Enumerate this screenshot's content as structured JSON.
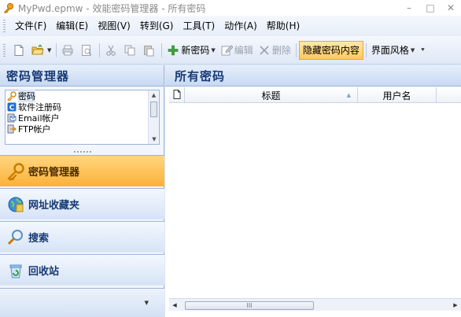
{
  "window": {
    "title": "MyPwd.epmw - 效能密码管理器 - 所有密码",
    "minimize": "–",
    "maximize": "□",
    "close": "✕"
  },
  "menu": [
    "文件(F)",
    "编辑(E)",
    "视图(V)",
    "转到(G)",
    "工具(T)",
    "动作(A)",
    "帮助(H)"
  ],
  "toolbar": {
    "new_label": "新密码",
    "edit_label": "编辑",
    "delete_label": "删除",
    "hide_label": "隐藏密码内容",
    "theme_label": "界面风格"
  },
  "left": {
    "title": "密码管理器",
    "tree": [
      {
        "label": "密码",
        "icon": "key-icon"
      },
      {
        "label": "软件注册码",
        "icon": "software-icon"
      },
      {
        "label": "Email帐户",
        "icon": "email-icon"
      },
      {
        "label": "FTP帐户",
        "icon": "ftp-icon"
      }
    ],
    "nav": [
      {
        "label": "密码管理器",
        "icon": "key-icon",
        "active": true
      },
      {
        "label": "网址收藏夹",
        "icon": "globe-icon",
        "active": false
      },
      {
        "label": "搜索",
        "icon": "search-icon",
        "active": false
      },
      {
        "label": "回收站",
        "icon": "recycle-icon",
        "active": false
      }
    ]
  },
  "right": {
    "title": "所有密码",
    "columns": [
      "标题",
      "用户名"
    ],
    "scroll_thumb_label": "III"
  },
  "colors": {
    "accent": "#fbb13a",
    "header_text": "#173a75"
  }
}
